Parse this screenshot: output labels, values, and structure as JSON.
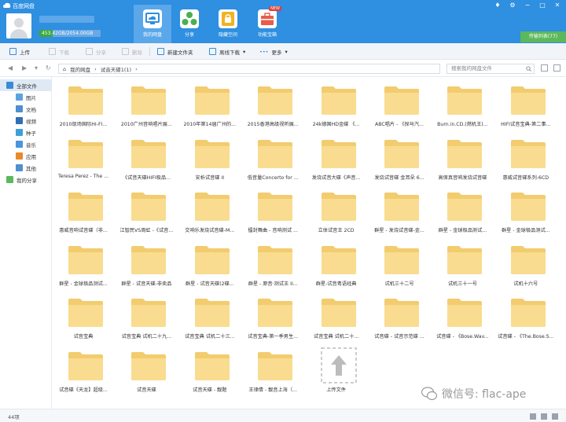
{
  "header": {
    "app_title": "百度网盘",
    "quota": "453.42GB/2054.00GB",
    "quota_fraction": 0.22,
    "tabs": [
      {
        "label": "我的网盘",
        "icon": "cloud-drive-icon"
      },
      {
        "label": "分享",
        "icon": "share-icon"
      },
      {
        "label": "隐藏空间",
        "icon": "lock-icon"
      },
      {
        "label": "功能宝箱",
        "icon": "toolbox-icon"
      }
    ],
    "new_badge": "NEW",
    "transfer_label": "传输列表(77)"
  },
  "toolbar": {
    "upload": "上传",
    "download": "下载",
    "share": "分享",
    "delete": "删除",
    "new_folder": "新建文件夹",
    "offline_download": "离线下载",
    "more": "更多"
  },
  "addressbar": {
    "root": "我的网盘",
    "current": "试音天碟1(1)",
    "search_placeholder": "搜索我的网盘文件"
  },
  "sidebar": {
    "items": [
      {
        "label": "全部文件",
        "color": "#3a8ad6"
      },
      {
        "label": "图片",
        "color": "#5ba3e0"
      },
      {
        "label": "文档",
        "color": "#4f8fd0"
      },
      {
        "label": "视频",
        "color": "#2e6fb8"
      },
      {
        "label": "种子",
        "color": "#3c9fd9"
      },
      {
        "label": "音乐",
        "color": "#4a95db"
      },
      {
        "label": "应用",
        "color": "#e88a2a"
      },
      {
        "label": "其他",
        "color": "#4f8fd0"
      },
      {
        "label": "我的分享",
        "color": "#5cb85c"
      }
    ]
  },
  "files": [
    "2010现场国际HI-FI...",
    "2010广州音响唱片展...",
    "2010年第14届广州的...",
    "2015香港高级视听展...",
    "24k德国HD金碟 《...",
    "ABC唱片 - 《探马汽...",
    "Burn.in.CD.(燃机王)...",
    "HIFI试音宝典-第二事...",
    "Teresa Perez - The ...",
    "《试音天碟HIFI极品...",
    "安析试音碟 II",
    "低音量Concerto for ...",
    "发烧试音大碟《声音...",
    "发烧试音碟 金耳朵 6...",
    "高保真音响发烧试音碟",
    "惠威试音碟系列-6CD",
    "惠威音响试音碟（非...",
    "江智民VS周虹 -《试音...",
    "交响乐发烧试音碟-M...",
    "擂封舞曲 - 音响测试 ...",
    "立体试音王 2CD",
    "群星 - 发烧试音碟-金...",
    "群星 - 金球极品测试...",
    "群星 - 金球极品测试...",
    "群星 - 金球极品测试...",
    "群星 - 试音天碟-非卖品",
    "群星 - 试音天碟(2碟...",
    "群星 - 原音·测试王 II...",
    "群星-试音粤语经典",
    "试机三十二号",
    "试机三十一号",
    "试机十六号",
    "试音宝典",
    "试音宝典 试机二十九...",
    "试音宝典 试机二十三...",
    "试音宝典-第一季男生...",
    "试音宝典 试机二十...",
    "试音碟 - 试音示范碟 ...",
    "试音碟 - 《Bose.Wav...",
    "试音碟 - 《The.Bose.S...",
    "试音碟《天龙】超级...",
    "试音天碟",
    "试音天碟 - 靓题",
    "王律倩 - 靓音上海（..."
  ],
  "upload_placeholder_label": "上传文件",
  "status": {
    "count": "44项"
  },
  "watermark": {
    "text": "微信号: flac-ape"
  }
}
